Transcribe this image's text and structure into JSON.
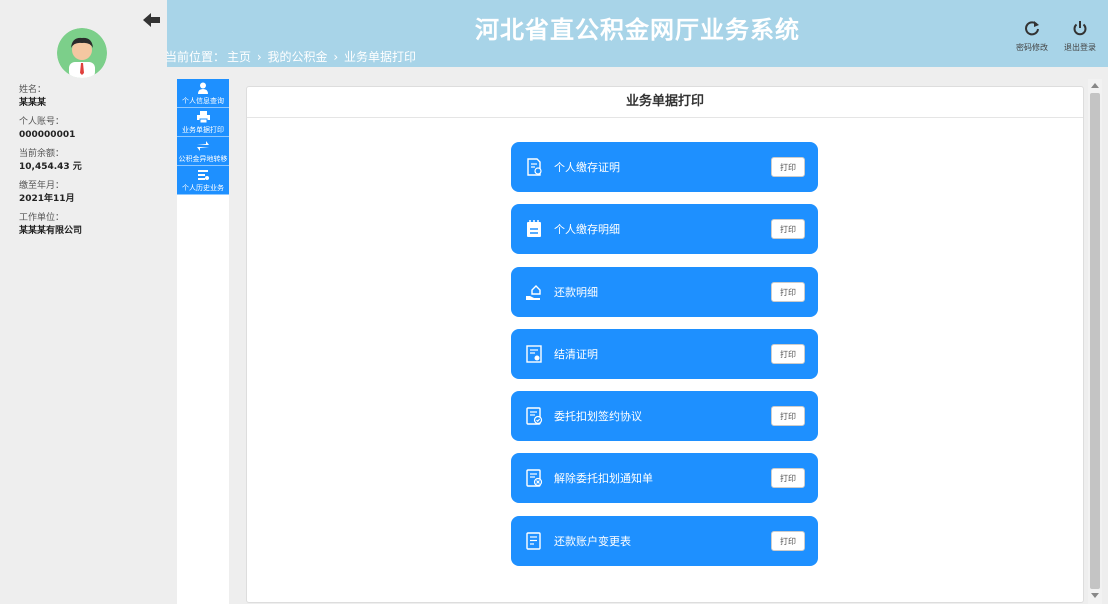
{
  "header": {
    "title": "河北省直公积金网厅业务系统",
    "breadcrumb_prefix": "当前位置：",
    "breadcrumb": [
      "主页",
      "我的公积金",
      "业务单据打印"
    ],
    "breadcrumb_sep": "›",
    "buttons": {
      "password": {
        "label": "密码修改",
        "icon": "refresh-icon"
      },
      "logout": {
        "label": "退出登录",
        "icon": "power-icon"
      }
    }
  },
  "user": {
    "fields": [
      {
        "label": "姓名：",
        "value": "某某某"
      },
      {
        "label": "个人账号：",
        "value": "000000001"
      },
      {
        "label": "当前余额：",
        "value": "10,454.43 元"
      },
      {
        "label": "缴至年月：",
        "value": "2021年11月"
      },
      {
        "label": "工作单位：",
        "value": "某某某有限公司"
      }
    ]
  },
  "menu": [
    {
      "label": "个人信息查询",
      "icon": "person-icon"
    },
    {
      "label": "业务单据打印",
      "icon": "printer-icon"
    },
    {
      "label": "公积金异地转移",
      "icon": "transfer-icon"
    },
    {
      "label": "个人历史业务",
      "icon": "history-icon"
    }
  ],
  "main": {
    "title": "业务单据打印",
    "print_button_label": "打印",
    "items": [
      {
        "label": "个人缴存证明",
        "icon": "document-icon"
      },
      {
        "label": "个人缴存明细",
        "icon": "notepad-icon"
      },
      {
        "label": "还款明细",
        "icon": "hand-house-icon"
      },
      {
        "label": "结清证明",
        "icon": "certificate-icon"
      },
      {
        "label": "委托扣划签约协议",
        "icon": "contract-check-icon"
      },
      {
        "label": "解除委托扣划通知单",
        "icon": "contract-cancel-icon"
      },
      {
        "label": "还款账户变更表",
        "icon": "form-icon"
      }
    ]
  },
  "colors": {
    "accent": "#1e90ff",
    "header": "#a8d4e8"
  }
}
